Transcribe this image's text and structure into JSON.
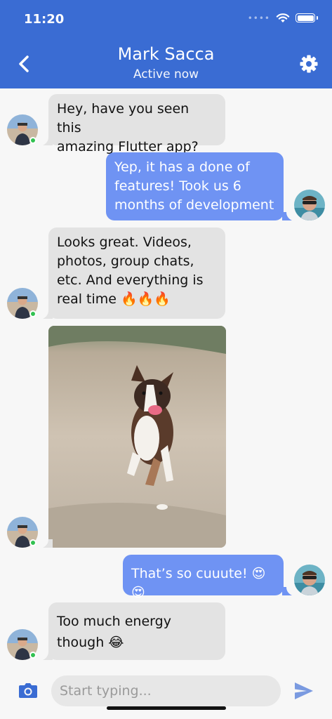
{
  "status_bar": {
    "time": "11:20"
  },
  "header": {
    "title": "Mark Sacca",
    "subtitle": "Active now",
    "back_icon": "chevron-left-icon",
    "settings_icon": "gear-icon"
  },
  "messages": [
    {
      "side": "in",
      "text": "Hey, have you seen this\namazing Flutter app?"
    },
    {
      "side": "out",
      "text": "Yep, it has a done of\nfeatures! Took us 6\nmonths of development"
    },
    {
      "side": "in",
      "text": "Looks great. Videos,\nphotos, group chats,\netc. And everything is\nreal time 🔥🔥🔥"
    },
    {
      "side": "in",
      "type": "image",
      "text": ""
    },
    {
      "side": "out",
      "text": "That’s so cuuute! 😍😍"
    },
    {
      "side": "in",
      "text": "Too much energy\nthough 😂"
    }
  ],
  "composer": {
    "placeholder": "Start typing...",
    "camera_icon": "camera-icon",
    "send_icon": "send-icon"
  },
  "colors": {
    "header": "#3a6cd3",
    "outgoing": "#6f93f3",
    "incoming": "#e3e3e3",
    "online": "#32c151"
  }
}
